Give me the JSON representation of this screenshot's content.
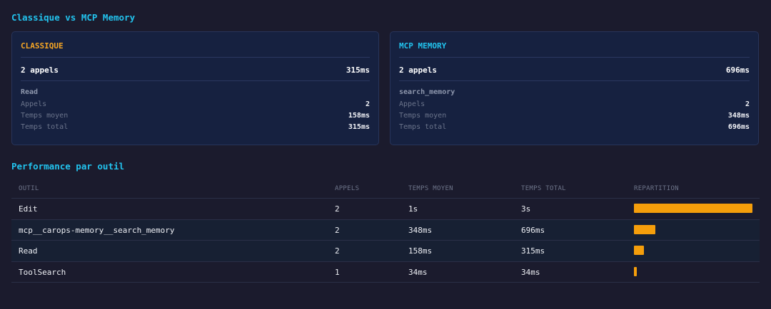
{
  "section1_title": "Classique vs MCP Memory",
  "cards": [
    {
      "title": "CLASSIQUE",
      "title_color": "#f5a524",
      "calls_summary": "2 appels",
      "total_summary": "315ms",
      "tool": "Read",
      "stats": [
        {
          "label": "Appels",
          "value": "2"
        },
        {
          "label": "Temps moyen",
          "value": "158ms"
        },
        {
          "label": "Temps total",
          "value": "315ms"
        }
      ]
    },
    {
      "title": "MCP MEMORY",
      "title_color": "#22c3ee",
      "calls_summary": "2 appels",
      "total_summary": "696ms",
      "tool": "search_memory",
      "stats": [
        {
          "label": "Appels",
          "value": "2"
        },
        {
          "label": "Temps moyen",
          "value": "348ms"
        },
        {
          "label": "Temps total",
          "value": "696ms"
        }
      ]
    }
  ],
  "section2_title": "Performance par outil",
  "table": {
    "headers": [
      "OUTIL",
      "APPELS",
      "TEMPS MOYEN",
      "TEMPS TOTAL",
      "REPARTITION"
    ],
    "rows": [
      {
        "tool": "Edit",
        "calls": "2",
        "avg": "1s",
        "total": "3s",
        "share": 1.0
      },
      {
        "tool": "mcp__carops-memory__search_memory",
        "calls": "2",
        "avg": "348ms",
        "total": "696ms",
        "share": 0.18
      },
      {
        "tool": "Read",
        "calls": "2",
        "avg": "158ms",
        "total": "315ms",
        "share": 0.085
      },
      {
        "tool": "ToolSearch",
        "calls": "1",
        "avg": "34ms",
        "total": "34ms",
        "share": 0.025
      }
    ],
    "bar_color": "#f59e0b"
  }
}
